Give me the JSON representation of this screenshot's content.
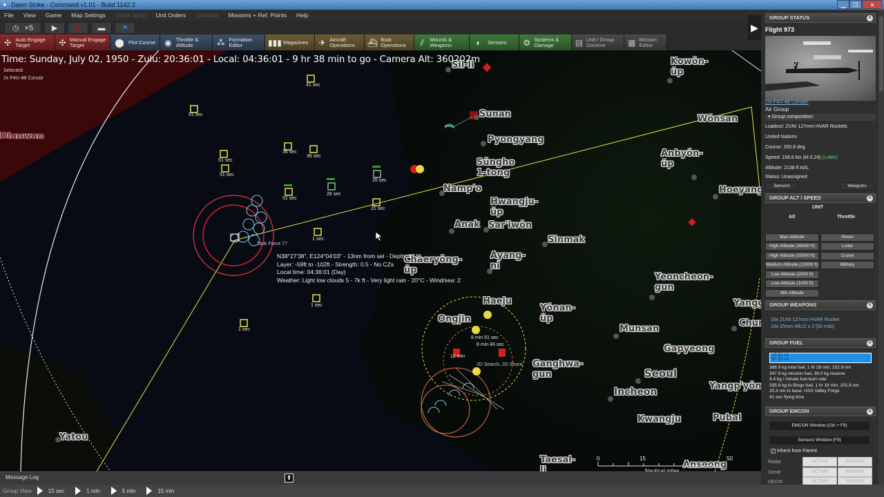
{
  "window": {
    "title": "Dawn Strike - Command v1.01 - Build 1142.2",
    "controls": [
      "minimize",
      "restore",
      "close"
    ]
  },
  "menu": [
    {
      "label": "File",
      "enabled": true
    },
    {
      "label": "View",
      "enabled": true
    },
    {
      "label": "Game",
      "enabled": true
    },
    {
      "label": "Map Settings",
      "enabled": true
    },
    {
      "label": "Quick Jump",
      "enabled": false
    },
    {
      "label": "Unit Orders",
      "enabled": true
    },
    {
      "label": "Contacts",
      "enabled": false
    },
    {
      "label": "Missions + Ref. Points",
      "enabled": true
    },
    {
      "label": "Help",
      "enabled": true
    }
  ],
  "timecontrols": {
    "compression": "×5",
    "clock_icon": "clock-icon",
    "play_icon": "play-icon",
    "record_icon": "record-icon",
    "bridge_icon": "ship-icon",
    "flag_icon": "flag-icon"
  },
  "toolbar": [
    {
      "label": "Auto Engage Target",
      "color": "red",
      "icon": "target-icon"
    },
    {
      "label": "Manual Engage Target",
      "color": "red",
      "icon": "target-icon"
    },
    {
      "label": "Plot Course",
      "color": "blue",
      "icon": "course-icon"
    },
    {
      "label": "Throttle & Altitude",
      "color": "blue",
      "icon": "throttle-icon"
    },
    {
      "label": "Formation Editor",
      "color": "blue",
      "icon": "formation-icon"
    },
    {
      "label": "Magazines",
      "color": "gold",
      "icon": "magazine-icon"
    },
    {
      "label": "Aircraft Operations",
      "color": "gold",
      "icon": "aircraft-icon"
    },
    {
      "label": "Boat Operations",
      "color": "gold",
      "icon": "boat-icon"
    },
    {
      "label": "Mounts & Weapons",
      "color": "green",
      "icon": "weapons-icon"
    },
    {
      "label": "Sensors",
      "color": "green",
      "icon": "sensor-icon"
    },
    {
      "label": "Systems & Damage",
      "color": "green",
      "icon": "gear-icon"
    },
    {
      "label": "Unit / Group Doctrine",
      "color": "grey",
      "icon": "doctrine-icon"
    },
    {
      "label": "Mission Editor",
      "color": "grey",
      "icon": "mission-icon"
    }
  ],
  "map": {
    "status_line": "Time: Sunday, July 02, 1950 - Zulu: 20:36:01 - Local: 04:36:01 - 9 hr 38 min to go -  Camera Alt: 360202m",
    "selected_label": "Selected:",
    "selected_unit": "2x F4U-4B Corsair",
    "cursor_info": [
      "N38°27'38\", E124°04'03\" - 13nm from sel - Depth: 174ft",
      "Layer: -59ft to -102ft - Strength: 0.5 - No CZs",
      "Local time: 04:36:01 (Day)",
      "Weather: Light low clouds 5 - 7k ft - Very light rain - 20°C - Wind/sea: 2"
    ],
    "cities": [
      {
        "name": "Sil-li"
      },
      {
        "name": "Sunan"
      },
      {
        "name": "Pyongyang"
      },
      {
        "name": "Sŭngho 1-tong"
      },
      {
        "name": "Namp'o"
      },
      {
        "name": "Hwangju-ŭp"
      },
      {
        "name": "Anak"
      },
      {
        "name": "Sar'iwŏn"
      },
      {
        "name": "Sinmak"
      },
      {
        "name": "Chaeryŏng-ŭp"
      },
      {
        "name": "Ayang-ni"
      },
      {
        "name": "Kowŏn-ŭp"
      },
      {
        "name": "Wŏnsan"
      },
      {
        "name": "Anbyŏn-ŭp"
      },
      {
        "name": "Hoeyang"
      },
      {
        "name": "Yeoncheon-gun"
      },
      {
        "name": "Haeju"
      },
      {
        "name": "Ongjin"
      },
      {
        "name": "Yŏnan-ŭp"
      },
      {
        "name": "Munsan"
      },
      {
        "name": "Gapyeong"
      },
      {
        "name": "Ganghwa-gun"
      },
      {
        "name": "Seoul"
      },
      {
        "name": "Incheon"
      },
      {
        "name": "Yangp'yŏng"
      },
      {
        "name": "Kwangju"
      },
      {
        "name": "Pubal"
      },
      {
        "name": "Yanggu"
      },
      {
        "name": "Chun"
      },
      {
        "name": "Taesal-li"
      },
      {
        "name": "Anseong"
      },
      {
        "name": "Dianwan"
      },
      {
        "name": "Yatou"
      }
    ],
    "contact_labels": [
      "41 sec",
      "51 sec",
      "51 sec",
      "51 sec",
      "36 sec",
      "36 sec",
      "51 sec",
      "26 sec",
      "26 sec",
      "21 sec",
      "1 sec",
      "1 sec",
      "1 sec"
    ],
    "group_labels": [
      "8 min 51 sec",
      "8 min 46 sec",
      "12 min",
      "2D Search, 2D Shore",
      "Task Force 77"
    ],
    "scale": {
      "ticks": [
        "0",
        "15",
        "50"
      ],
      "unit": "Nautical miles"
    }
  },
  "message_log": {
    "label": "Message Log"
  },
  "group_view": {
    "label": "Group View",
    "options": [
      "15 sec",
      "1 min",
      "5 min",
      "15 min"
    ]
  },
  "panel": {
    "group_status": {
      "header": "GROUP STATUS",
      "name": "Flight 973",
      "unit_link": "(2x F4U-4B Corsair)",
      "type": "Air Group",
      "composition_label": "Group composition:",
      "loadout": "Loadout: ZUNI 127mm HVAR Rockets",
      "side": "United Nations",
      "course": "Course: 200.8 deg",
      "speed": "Speed: 158.6 kts (M 0.24)",
      "speed_mode": "(Loiter)",
      "altitude": "Altitude: 2138 ft ASL",
      "status": "Status: Unassigned",
      "sensors_btn": "Sensors",
      "weapons_btn": "Weapons"
    },
    "alt_speed": {
      "header": "GROUP ALT / SPEED",
      "unit_label": "UNIT",
      "alt_label": "Alt",
      "throttle_label": "Throttle",
      "altitudes": [
        "Max Altitude",
        "High Altitude (36000 ft)",
        "High Altitude (25000 ft)",
        "Medium Altitude (12000 ft)",
        "Low Altitude (2000 ft)",
        "Low Altitude (1000 ft)",
        "Min Altitude"
      ],
      "throttles": [
        "Hover",
        "Loiter",
        "Cruise",
        "Military"
      ]
    },
    "weapons": {
      "header": "GROUP WEAPONS",
      "items": [
        "16x ZUNI 127mm HVAR Rocket",
        "16x 20mm Mk12 x 2 [50 rnds]"
      ]
    },
    "fuel": {
      "header": "GROUP FUEL",
      "aircraft": [
        "VF-53 #3",
        "VF-53 #4"
      ],
      "lines": [
        "386.9 kg total fuel, 1 hr 28 min, 232.9 nm",
        "347.9 kg mission fuel, 39.0 kg reserve",
        "4.4 kg / minute fuel burn rate",
        "335.6 kg to Bingo fuel, 1 hr 16 min, 201.9 nm",
        "20.3 nm to base: USS Valley Forge",
        "41 sec flying time"
      ]
    },
    "emcon": {
      "header": "GROUP EMCON",
      "emcon_btn": "EMCON Window (Ctrl + F9)",
      "sensors_btn": "Sensors Window (F9)",
      "inherit_label": "Inherit from Parent",
      "inherit_checked": true,
      "rows": [
        {
          "label": "Radar",
          "active": "ACTIVE",
          "passive": "PASSIVE"
        },
        {
          "label": "Sonar",
          "active": "ACTIVE",
          "passive": "PASSIVE"
        },
        {
          "label": "OECM",
          "active": "ACTIVE",
          "passive": "PASSIVE"
        }
      ]
    }
  }
}
